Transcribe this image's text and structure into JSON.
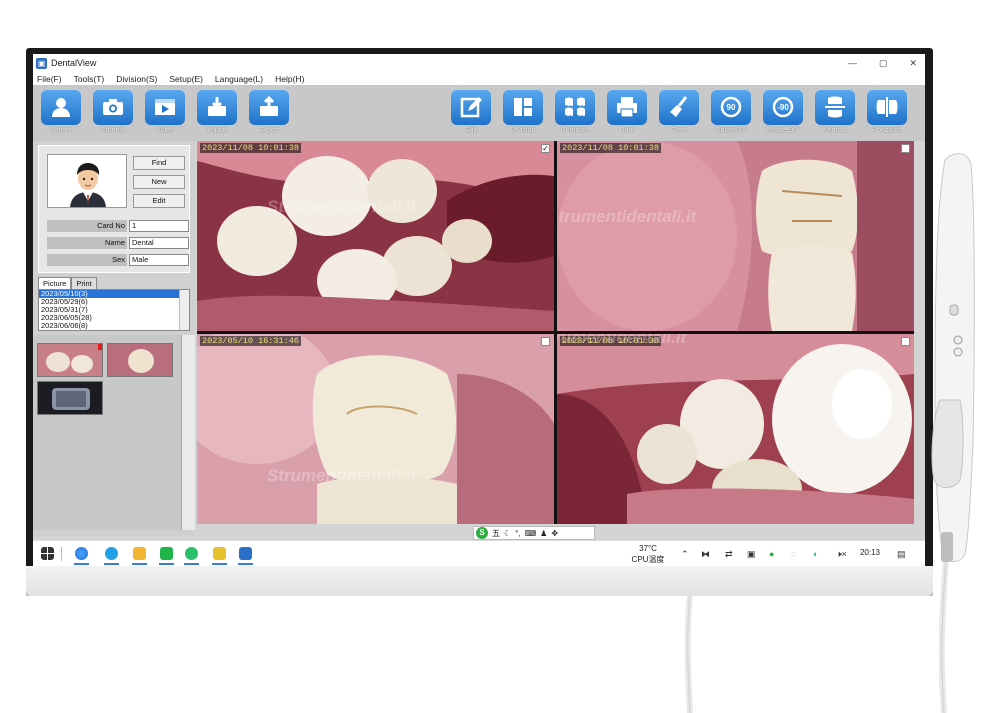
{
  "window": {
    "title": "DentalView",
    "controls": [
      "—",
      "▢",
      "✕"
    ]
  },
  "menu": [
    "File(F)",
    "Tools(T)",
    "Division(S)",
    "Setup(E)",
    "Language(L)",
    "Help(H)"
  ],
  "toolbar_left": [
    {
      "label": "Patient",
      "icon": "patient-icon"
    },
    {
      "label": "Camera",
      "icon": "camera-icon"
    },
    {
      "label": "Video",
      "icon": "video-icon"
    },
    {
      "label": "Import",
      "icon": "import-icon"
    },
    {
      "label": "Export",
      "icon": "export-icon"
    }
  ],
  "toolbar_right": [
    {
      "label": "Edit",
      "icon": "edit-icon"
    },
    {
      "label": "Division",
      "icon": "division-icon"
    },
    {
      "label": "Compare",
      "icon": "compare-icon"
    },
    {
      "label": "Print",
      "icon": "printer-icon"
    },
    {
      "label": "Clear",
      "icon": "broom-icon"
    },
    {
      "label": "Rotate90°",
      "icon": "rotate-right-icon"
    },
    {
      "label": "Rotate-90°",
      "icon": "rotate-left-icon"
    },
    {
      "label": "Vertical",
      "icon": "vertical-flip-icon"
    },
    {
      "label": "Horizonta",
      "icon": "horizontal-flip-icon"
    }
  ],
  "patient": {
    "find_label": "Find",
    "new_label": "New",
    "edit_label": "Edit",
    "fields": [
      {
        "label": "Card No",
        "value": "1"
      },
      {
        "label": "Name",
        "value": "Dental"
      },
      {
        "label": "Sex",
        "value": "Male"
      }
    ]
  },
  "tabs": [
    "Picture",
    "Print"
  ],
  "dates": [
    "2023/05/10(3)",
    "2023/05/29(6)",
    "2023/05/31(7)",
    "2023/06/05(28)",
    "2023/06/06(8)"
  ],
  "cells": [
    {
      "timestamp": "2023/11/08 10:01:38",
      "checked": "✓"
    },
    {
      "timestamp": "2023/11/08 10:01:38",
      "checked": ""
    },
    {
      "timestamp": "2023/05/10 16:31:46",
      "checked": ""
    },
    {
      "timestamp": "2023/11/08 10:01:38",
      "checked": ""
    }
  ],
  "watermark": "Strumentidentali.it",
  "ime": {
    "s": "S",
    "char": "五",
    "extra": "°,"
  },
  "taskbar": {
    "temp": "37°C",
    "cpu": "CPU温度",
    "clock": "20:13"
  },
  "colors": {
    "toolbar_bg": "#c8c8c8",
    "button_blue": "#1f72c9",
    "timestamp": "#e9e07a",
    "selection": "#2a73d6"
  }
}
